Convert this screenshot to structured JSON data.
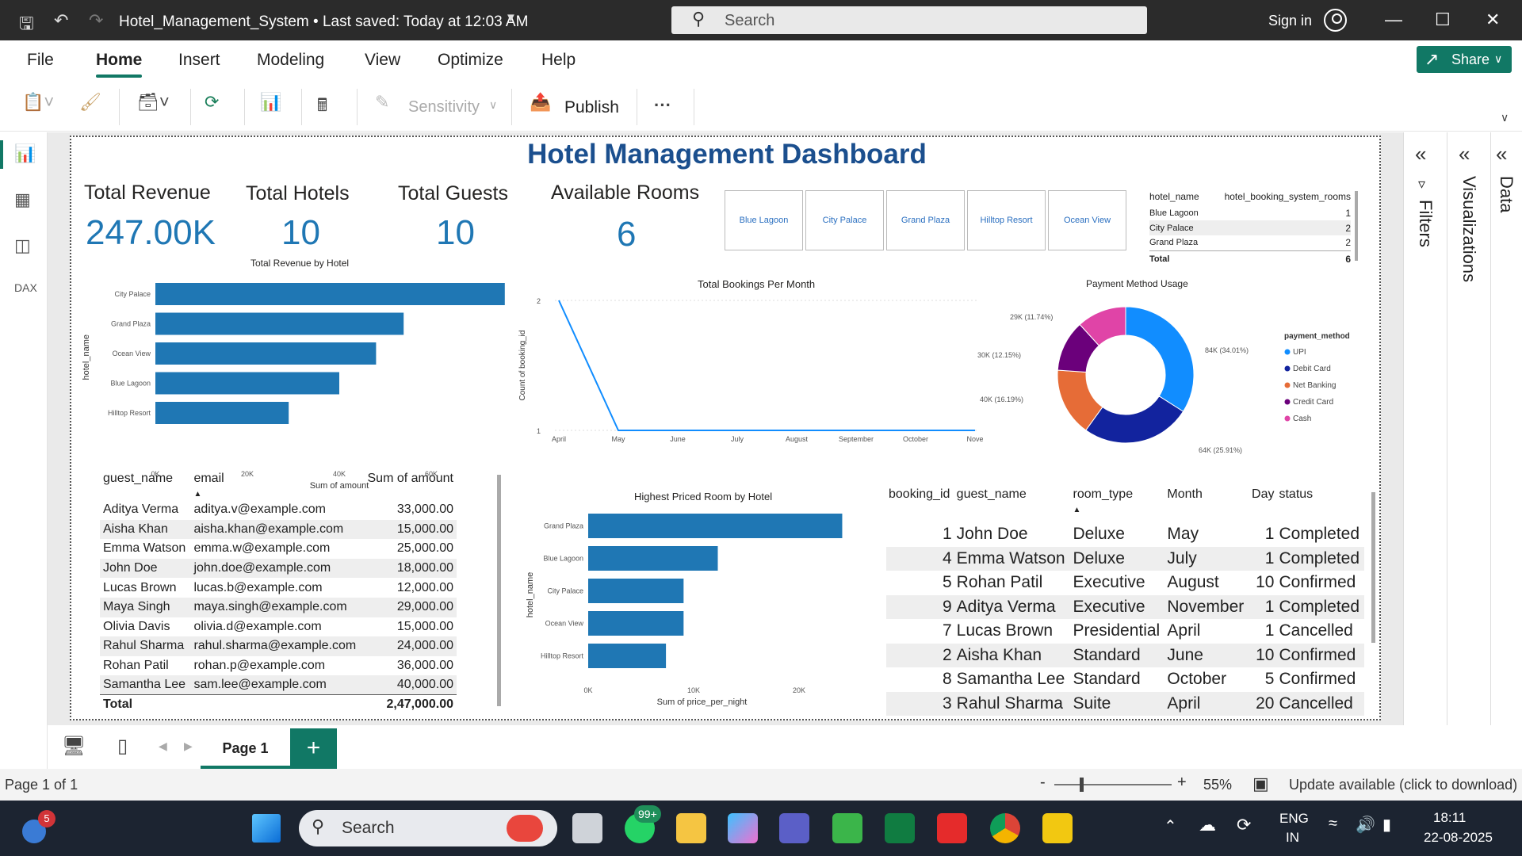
{
  "titlebar": {
    "doc_title": "Hotel_Management_System • Last saved: Today at 12:03 AM",
    "search_placeholder": "Search",
    "signin": "Sign in"
  },
  "menu": {
    "items": [
      "File",
      "Home",
      "Insert",
      "Modeling",
      "View",
      "Optimize",
      "Help"
    ],
    "share": "Share"
  },
  "ribbon": {
    "sensitivity": "Sensitivity",
    "publish": "Publish",
    "more": "···"
  },
  "right_panels": [
    "Filters",
    "Visualizations",
    "Data"
  ],
  "dashboard": {
    "title": "Hotel Management Dashboard",
    "cards": [
      {
        "label": "Total Revenue",
        "value": "247.00K"
      },
      {
        "label": "Total Hotels",
        "value": "10"
      },
      {
        "label": "Total Guests",
        "value": "10"
      },
      {
        "label": "Available Rooms",
        "value": "6"
      }
    ],
    "slicer": [
      "Blue Lagoon",
      "City Palace",
      "Grand Plaza",
      "Hilltop Resort",
      "Ocean View"
    ],
    "rooms_table": {
      "headers": [
        "hotel_name",
        "hotel_booking_system_rooms"
      ],
      "rows": [
        [
          "Blue Lagoon",
          "1"
        ],
        [
          "City Palace",
          "2"
        ],
        [
          "Grand Plaza",
          "2"
        ]
      ],
      "total": [
        "Total",
        "6"
      ]
    },
    "guest_table": {
      "headers": [
        "guest_name",
        "email",
        "Sum of amount"
      ],
      "rows": [
        [
          "Aditya Verma",
          "aditya.v@example.com",
          "33,000.00"
        ],
        [
          "Aisha Khan",
          "aisha.khan@example.com",
          "15,000.00"
        ],
        [
          "Emma Watson",
          "emma.w@example.com",
          "25,000.00"
        ],
        [
          "John Doe",
          "john.doe@example.com",
          "18,000.00"
        ],
        [
          "Lucas Brown",
          "lucas.b@example.com",
          "12,000.00"
        ],
        [
          "Maya Singh",
          "maya.singh@example.com",
          "29,000.00"
        ],
        [
          "Olivia Davis",
          "olivia.d@example.com",
          "15,000.00"
        ],
        [
          "Rahul Sharma",
          "rahul.sharma@example.com",
          "24,000.00"
        ],
        [
          "Rohan Patil",
          "rohan.p@example.com",
          "36,000.00"
        ],
        [
          "Samantha Lee",
          "sam.lee@example.com",
          "40,000.00"
        ]
      ],
      "total": [
        "Total",
        "",
        "2,47,000.00"
      ]
    },
    "booking_table": {
      "headers": [
        "booking_id",
        "guest_name",
        "room_type",
        "Month",
        "Day",
        "status"
      ],
      "rows": [
        [
          "1",
          "John Doe",
          "Deluxe",
          "May",
          "1",
          "Completed"
        ],
        [
          "4",
          "Emma Watson",
          "Deluxe",
          "July",
          "1",
          "Completed"
        ],
        [
          "5",
          "Rohan Patil",
          "Executive",
          "August",
          "10",
          "Confirmed"
        ],
        [
          "9",
          "Aditya Verma",
          "Executive",
          "November",
          "1",
          "Completed"
        ],
        [
          "7",
          "Lucas Brown",
          "Presidential",
          "April",
          "1",
          "Cancelled"
        ],
        [
          "2",
          "Aisha Khan",
          "Standard",
          "June",
          "10",
          "Confirmed"
        ],
        [
          "8",
          "Samantha Lee",
          "Standard",
          "October",
          "5",
          "Confirmed"
        ],
        [
          "3",
          "Rahul Sharma",
          "Suite",
          "April",
          "20",
          "Cancelled"
        ]
      ]
    }
  },
  "chart_data": [
    {
      "type": "bar",
      "orientation": "horizontal",
      "title": "Total Revenue by Hotel",
      "xlabel": "Sum of amount",
      "ylabel": "hotel_name",
      "categories": [
        "City Palace",
        "Grand Plaza",
        "Ocean View",
        "Blue Lagoon",
        "Hilltop Resort"
      ],
      "values": [
        76000,
        54000,
        48000,
        40000,
        29000
      ],
      "xlim": [
        0,
        80000
      ],
      "xticks": [
        "0K",
        "20K",
        "40K",
        "60K",
        "80K"
      ],
      "color": "#1f77b4"
    },
    {
      "type": "line",
      "title": "Total Bookings Per Month",
      "xlabel": "Month",
      "ylabel": "Count of booking_id",
      "categories": [
        "April",
        "May",
        "June",
        "July",
        "August",
        "September",
        "October",
        "Nove"
      ],
      "values": [
        2,
        1,
        1,
        1,
        1,
        1,
        1,
        1
      ],
      "ylim": [
        1,
        2
      ],
      "yticks": [
        "1",
        "2"
      ],
      "color": "#118dff"
    },
    {
      "type": "pie",
      "donut": true,
      "title": "Payment Method Usage",
      "legend_title": "payment_method",
      "labels": [
        "UPI",
        "Debit Card",
        "Net Banking",
        "Credit Card",
        "Cash"
      ],
      "values": [
        84,
        64,
        40,
        30,
        29
      ],
      "data_labels": [
        "84K (34.01%)",
        "64K (25.91%)",
        "40K (16.19%)",
        "30K (12.15%)",
        "29K (11.74%)"
      ],
      "colors": [
        "#118dff",
        "#12239e",
        "#e66c37",
        "#6b007b",
        "#e044a7"
      ]
    },
    {
      "type": "bar",
      "orientation": "horizontal",
      "title": "Highest Priced Room by Hotel",
      "xlabel": "Sum of price_per_night",
      "ylabel": "hotel_name",
      "categories": [
        "Grand Plaza",
        "Blue Lagoon",
        "City Palace",
        "Ocean View",
        "Hilltop Resort"
      ],
      "values": [
        24500,
        12500,
        9200,
        9200,
        7500
      ],
      "xlim": [
        0,
        25000
      ],
      "xticks": [
        "0K",
        "10K",
        "20K"
      ],
      "color": "#1f77b4"
    }
  ],
  "pages": {
    "tab": "Page 1",
    "add": "+"
  },
  "status": {
    "page": "Page 1 of 1",
    "zoom": "55%",
    "update": "Update available (click to download)"
  },
  "taskbar": {
    "search": "Search",
    "badge_left": "5",
    "badge_whatsapp": "99+",
    "lang1": "ENG",
    "lang2": "IN",
    "time": "18:11",
    "date": "22-08-2025"
  }
}
